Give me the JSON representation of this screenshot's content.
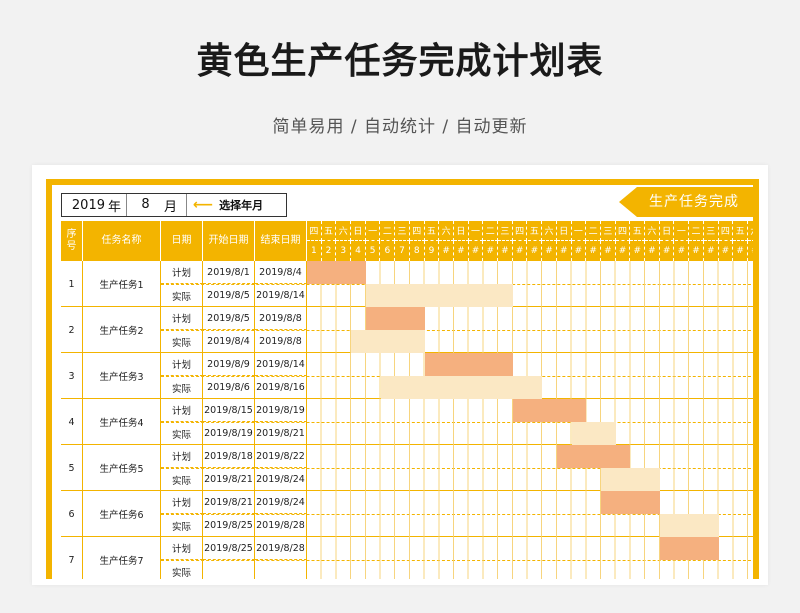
{
  "title": "黄色生产任务完成计划表",
  "subtitle": "简单易用 / 自动统计 / 自动更新",
  "selector": {
    "year": "2019",
    "year_unit": "年",
    "month": "8",
    "month_unit": "月",
    "hint": "选择年月"
  },
  "banner": "生产任务完成",
  "headers": {
    "seq_a": "序",
    "seq_b": "号",
    "name": "任务名称",
    "date": "日期",
    "start": "开始日期",
    "end": "结束日期"
  },
  "weekdays": [
    "四",
    "五",
    "六",
    "日",
    "一",
    "二",
    "三",
    "四",
    "五",
    "六",
    "日",
    "一",
    "二",
    "三",
    "四",
    "五",
    "六",
    "日",
    "一",
    "二",
    "三",
    "四",
    "五",
    "六",
    "日",
    "一",
    "二",
    "三",
    "四",
    "五",
    "六"
  ],
  "dates": [
    "1",
    "2",
    "3",
    "4",
    "5",
    "6",
    "7",
    "8",
    "9",
    "#",
    "#",
    "#",
    "#",
    "#",
    "#",
    "#",
    "#",
    "#",
    "#",
    "#",
    "#",
    "#",
    "#",
    "#",
    "#",
    "#",
    "#",
    "#",
    "#",
    "#",
    "#"
  ],
  "tasks": [
    {
      "seq": "1",
      "name": "生产任务1",
      "plan_label": "计划",
      "plan_start": "2019/8/1",
      "plan_end": "2019/8/4",
      "actual_label": "实际",
      "actual_start": "2019/8/5",
      "actual_end": "2019/8/14"
    },
    {
      "seq": "2",
      "name": "生产任务2",
      "plan_label": "计划",
      "plan_start": "2019/8/5",
      "plan_end": "2019/8/8",
      "actual_label": "实际",
      "actual_start": "2019/8/4",
      "actual_end": "2019/8/8"
    },
    {
      "seq": "3",
      "name": "生产任务3",
      "plan_label": "计划",
      "plan_start": "2019/8/9",
      "plan_end": "2019/8/14",
      "actual_label": "实际",
      "actual_start": "2019/8/6",
      "actual_end": "2019/8/16"
    },
    {
      "seq": "4",
      "name": "生产任务4",
      "plan_label": "计划",
      "plan_start": "2019/8/15",
      "plan_end": "2019/8/19",
      "actual_label": "实际",
      "actual_start": "2019/8/19",
      "actual_end": "2019/8/21"
    },
    {
      "seq": "5",
      "name": "生产任务5",
      "plan_label": "计划",
      "plan_start": "2019/8/18",
      "plan_end": "2019/8/22",
      "actual_label": "实际",
      "actual_start": "2019/8/21",
      "actual_end": "2019/8/24"
    },
    {
      "seq": "6",
      "name": "生产任务6",
      "plan_label": "计划",
      "plan_start": "2019/8/21",
      "plan_end": "2019/8/24",
      "actual_label": "实际",
      "actual_start": "2019/8/25",
      "actual_end": "2019/8/28"
    },
    {
      "seq": "7",
      "name": "生产任务7",
      "plan_label": "计划",
      "plan_start": "2019/8/25",
      "plan_end": "2019/8/28",
      "actual_label": "实际",
      "actual_start": "",
      "actual_end": ""
    }
  ],
  "colors": {
    "accent": "#f3b400",
    "plan_bar": "#f5b07f",
    "actual_bar": "#fbe8c4"
  }
}
